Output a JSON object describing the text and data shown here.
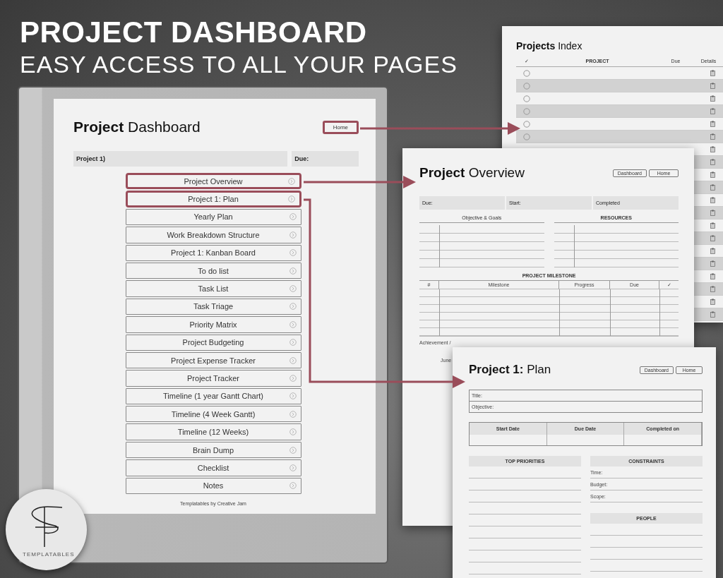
{
  "headline": {
    "title": "PROJECT DASHBOARD",
    "subtitle": "EASY ACCESS TO ALL YOUR PAGES"
  },
  "dashboard": {
    "title_bold": "Project",
    "title_rest": "Dashboard",
    "home_button": {
      "label": "Home",
      "highlighted": true
    },
    "fields": [
      "Project 1)",
      "Due:"
    ],
    "links": [
      {
        "label": "Project Overview",
        "highlighted": true
      },
      {
        "label": "Project 1: Plan",
        "highlighted": true
      },
      {
        "label": "Yearly Plan",
        "highlighted": false
      },
      {
        "label": "Work Breakdown Structure",
        "highlighted": false
      },
      {
        "label": "Project 1: Kanban Board",
        "highlighted": false
      },
      {
        "label": "To do list",
        "highlighted": false
      },
      {
        "label": "Task List",
        "highlighted": false
      },
      {
        "label": "Task Triage",
        "highlighted": false
      },
      {
        "label": "Priority Matrix",
        "highlighted": false
      },
      {
        "label": "Project Budgeting",
        "highlighted": false
      },
      {
        "label": "Project Expense Tracker",
        "highlighted": false
      },
      {
        "label": "Project Tracker",
        "highlighted": false
      },
      {
        "label": "Timeline (1 year Gantt Chart)",
        "highlighted": false
      },
      {
        "label": "Timeline (4 Week Gantt)",
        "highlighted": false
      },
      {
        "label": "Timeline (12 Weeks)",
        "highlighted": false
      },
      {
        "label": "Brain Dump",
        "highlighted": false
      },
      {
        "label": "Checklist",
        "highlighted": false
      },
      {
        "label": "Notes",
        "highlighted": false
      }
    ],
    "footer": "Templatables by Creative Jam"
  },
  "index_page": {
    "title_bold": "Projects",
    "title_rest": "Index",
    "columns": [
      "✓",
      "PROJECT",
      "Due",
      "Details"
    ],
    "rows": [
      {
        "kind": "full",
        "shaded": false
      },
      {
        "kind": "full",
        "shaded": true
      },
      {
        "kind": "full",
        "shaded": false
      },
      {
        "kind": "full",
        "shaded": true
      },
      {
        "kind": "full",
        "shaded": false
      },
      {
        "kind": "full",
        "shaded": true
      },
      {
        "kind": "edge",
        "shaded": false
      },
      {
        "kind": "edge",
        "shaded": true
      },
      {
        "kind": "edge",
        "shaded": false
      },
      {
        "kind": "edge",
        "shaded": true
      },
      {
        "kind": "edge",
        "shaded": false
      },
      {
        "kind": "edge",
        "shaded": true
      },
      {
        "kind": "edge",
        "shaded": false
      },
      {
        "kind": "edge",
        "shaded": true
      },
      {
        "kind": "edge",
        "shaded": false
      },
      {
        "kind": "edge",
        "shaded": true
      },
      {
        "kind": "edge",
        "shaded": false
      },
      {
        "kind": "edge",
        "shaded": true
      },
      {
        "kind": "edge",
        "shaded": false
      },
      {
        "kind": "edge",
        "shaded": true
      }
    ]
  },
  "overview_page": {
    "title_bold": "Project",
    "title_rest": "Overview",
    "buttons": [
      "Dashboard",
      "Home"
    ],
    "fields": [
      "Due:",
      "Start:",
      "Completed"
    ],
    "sections": [
      "Objective & Goals",
      "RESOURCES"
    ],
    "milestone_title": "PROJECT MILESTONE",
    "milestone_columns": [
      "#",
      "Milestone",
      "Progress",
      "Due",
      "✓"
    ],
    "notes": [
      "Achievement /",
      "June"
    ]
  },
  "plan_page": {
    "title_bold": "Project 1:",
    "title_rest": "Plan",
    "buttons": [
      "Dashboard",
      "Home"
    ],
    "fields": [
      "Title:",
      "Objective:"
    ],
    "dates": [
      "Start Date",
      "Due Date",
      "Completed on"
    ],
    "priorities": "TOP PRIORITIES",
    "constraints": {
      "heading": "CONSTRAINTS",
      "items": [
        "Time:",
        "Budget:",
        "Scope:"
      ]
    },
    "people": "PEOPLE"
  },
  "badge": {
    "label": "TEMPLATABLES"
  }
}
